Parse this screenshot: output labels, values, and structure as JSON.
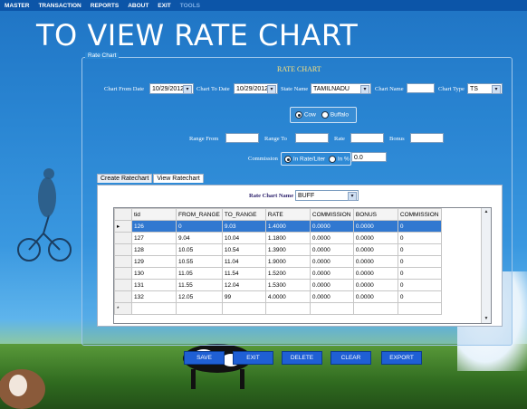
{
  "menu": [
    "MASTER",
    "TRANSACTION",
    "REPORTS",
    "ABOUT",
    "EXIT",
    "TOOLS"
  ],
  "banner": "TO VIEW RATE CHART",
  "panel_title": "Rate Chart",
  "form": {
    "heading": "RATE CHART",
    "chart_from_date_label": "Chart From Date",
    "chart_from_date_value": "10/29/2012",
    "chart_to_date_label": "Chart To Date",
    "chart_to_date_value": "10/29/2012",
    "state_name_label": "State Name",
    "state_name_value": "TAMILNADU",
    "chart_name_label": "Chart Name",
    "chart_name_value": "",
    "chart_type_label": "Chart Type",
    "chart_type_value": "TS",
    "animal_cow": "Cow",
    "animal_buffalo": "Buffalo",
    "range_from_label": "Range From",
    "range_to_label": "Range To",
    "rate_label": "Rate",
    "bonus_label": "Bonus",
    "commission_label": "Commission",
    "in_rate_label": "In Rate/Liter",
    "in_percent_label": "In %",
    "commission_value": "0.0"
  },
  "tabs": [
    "Create Ratechart",
    "View Ratechart"
  ],
  "view": {
    "rate_chart_name_label": "Rate Chart Name",
    "rate_chart_name_value": "BUFF"
  },
  "grid": {
    "columns": [
      "tid",
      "FROM_RANGE",
      "TO_RANGE",
      "RATE",
      "COMMISSION",
      "BONUS",
      "COMMISSION"
    ],
    "rows": [
      [
        "126",
        "0",
        "9.03",
        "1.4000",
        "0.0000",
        "0.0000",
        "0"
      ],
      [
        "127",
        "9.04",
        "10.04",
        "1.1800",
        "0.0000",
        "0.0000",
        "0"
      ],
      [
        "128",
        "10.05",
        "10.54",
        "1.3900",
        "0.0000",
        "0.0000",
        "0"
      ],
      [
        "129",
        "10.55",
        "11.04",
        "1.9000",
        "0.0000",
        "0.0000",
        "0"
      ],
      [
        "130",
        "11.05",
        "11.54",
        "1.5200",
        "0.0000",
        "0.0000",
        "0"
      ],
      [
        "131",
        "11.55",
        "12.04",
        "1.5300",
        "0.0000",
        "0.0000",
        "0"
      ],
      [
        "132",
        "12.05",
        "99",
        "4.0000",
        "0.0000",
        "0.0000",
        "0"
      ]
    ],
    "new_row_marker": "*",
    "current_row_marker": "▸"
  },
  "buttons": [
    "SAVE",
    "EXIT",
    "DELETE",
    "CLEAR",
    "EXPORT"
  ],
  "colors": {
    "button": "#1f5fd4",
    "selected_row": "#3178d0",
    "heading": "#fde27a"
  }
}
